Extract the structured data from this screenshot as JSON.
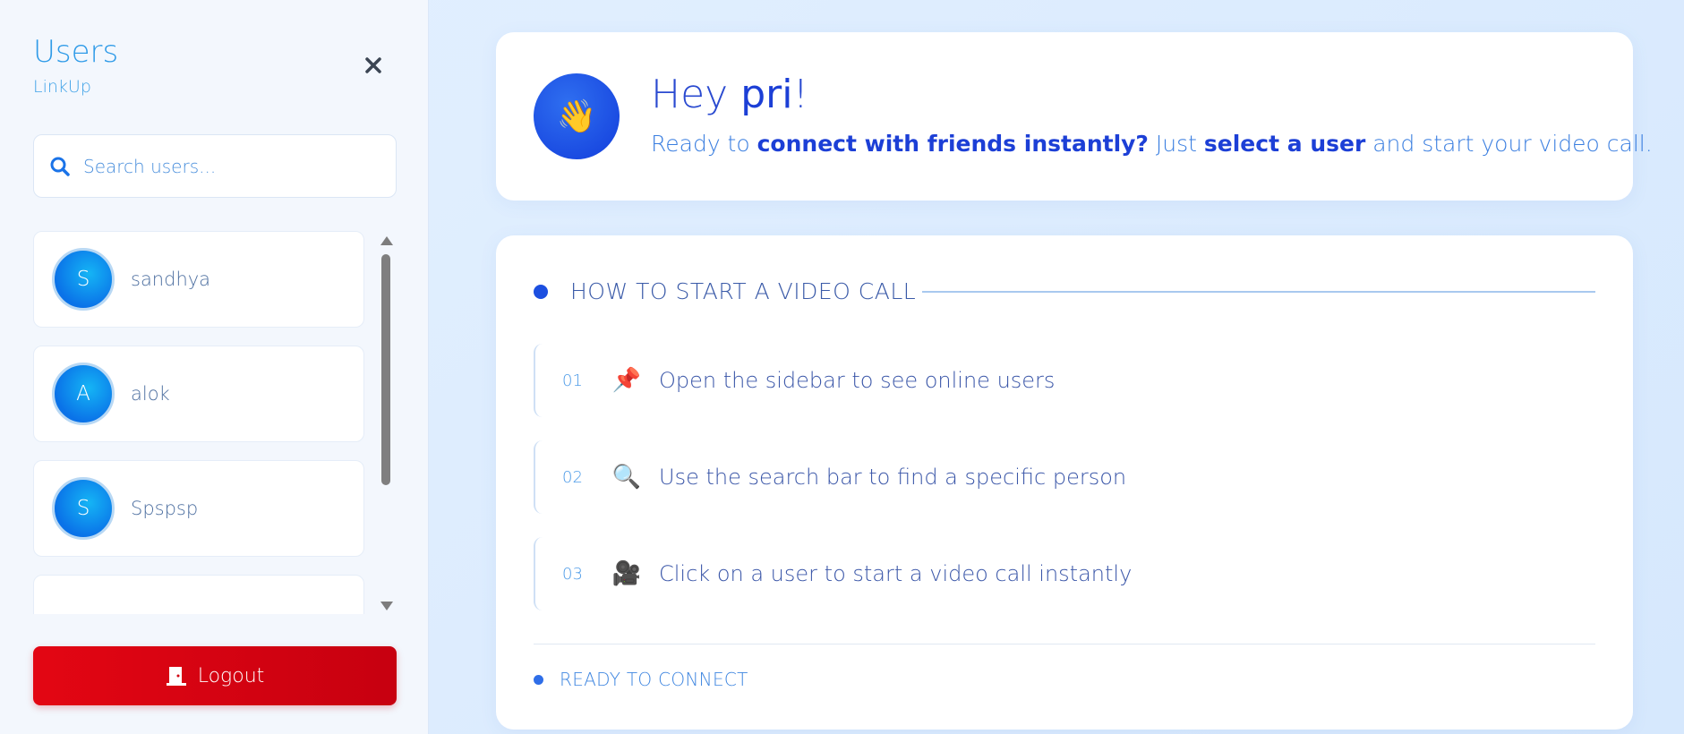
{
  "sidebar": {
    "title": "Users",
    "subtitle": "LinkUp",
    "close_icon": "close-icon",
    "search": {
      "placeholder": "Search users...",
      "value": ""
    },
    "users": [
      {
        "initial": "S",
        "name": "sandhya"
      },
      {
        "initial": "A",
        "name": "alok"
      },
      {
        "initial": "S",
        "name": "Spspsp"
      },
      {
        "initial": "",
        "name": ""
      }
    ],
    "logout_label": "Logout"
  },
  "greeting": {
    "hey": "Hey ",
    "username": "pri",
    "exclaim": "!",
    "avatar_emoji": "👋",
    "line_part1": "Ready to ",
    "line_bold1": "connect with friends instantly?",
    "line_part2": " Just ",
    "line_bold2": "select a user",
    "line_part3": " and start your video call."
  },
  "instructions": {
    "title": "HOW TO START A VIDEO CALL",
    "steps": [
      {
        "num": "01",
        "icon": "📌",
        "text": "Open the sidebar to see online users"
      },
      {
        "num": "02",
        "icon": "🔍",
        "text": "Use the search bar to find a specific person"
      },
      {
        "num": "03",
        "icon": "🎥",
        "text": "Click on a user to start a video call instantly"
      }
    ],
    "status": "READY TO CONNECT"
  },
  "colors": {
    "accent": "#1c3fd6",
    "logout": "#e30613",
    "avatar": "#0a72e8"
  }
}
